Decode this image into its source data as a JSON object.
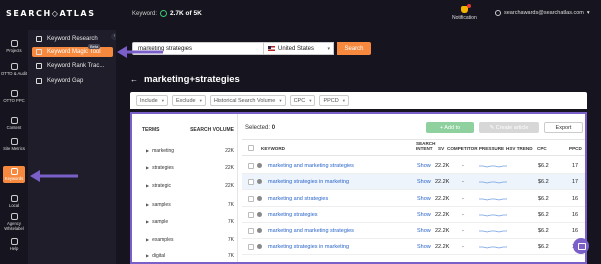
{
  "header": {
    "logo": "SEARCH◇ATLAS",
    "keyword_label": "Keyword:",
    "keyword_quota": "2.7K of 5K",
    "notification_label": "Notification",
    "account_email": "searchawards@searchatlas.com"
  },
  "rail": {
    "items": [
      {
        "label": "Projects",
        "icon": "folder-icon"
      },
      {
        "label": "OTTO & Audit",
        "icon": "otto-icon"
      },
      {
        "label": "OTTO PPC",
        "icon": "ppc-icon"
      },
      {
        "label": "Content",
        "icon": "content-icon"
      },
      {
        "label": "Site Metrics",
        "icon": "metrics-icon"
      },
      {
        "label": "Keywords",
        "icon": "keywords-icon"
      },
      {
        "label": "Local",
        "icon": "local-icon"
      },
      {
        "label": "Agency Whitelabel",
        "icon": "agency-icon"
      },
      {
        "label": "Help",
        "icon": "help-icon"
      }
    ]
  },
  "submenu": {
    "items": [
      {
        "label": "Keyword Research",
        "icon": "search-icon"
      },
      {
        "label": "Keyword Magic Tool",
        "icon": "magic-wand-icon",
        "badge": "Beta"
      },
      {
        "label": "Keyword Rank Trac...",
        "icon": "rank-icon"
      },
      {
        "label": "Keyword Gap",
        "icon": "gap-icon"
      }
    ],
    "beta_badge": "Beta"
  },
  "search": {
    "query": "marketing strategies",
    "country": "United States",
    "button": "Search"
  },
  "page": {
    "title": "marketing+strategies",
    "back_glyph": "←"
  },
  "filters": [
    "Include",
    "Exclude",
    "Historical Search Volume",
    "CPC",
    "PPCD"
  ],
  "groups": {
    "header_terms": "TERMS",
    "header_volume": "SEARCH VOLUME",
    "rows": [
      {
        "term": "marketing",
        "volume": "22K"
      },
      {
        "term": "strategies",
        "volume": "22K"
      },
      {
        "term": "strategic",
        "volume": "22K"
      },
      {
        "term": "samples",
        "volume": "7K"
      },
      {
        "term": "sample",
        "volume": "7K"
      },
      {
        "term": "examples",
        "volume": "7K"
      },
      {
        "term": "digital",
        "volume": "7K"
      }
    ]
  },
  "toolbar": {
    "selected_label": "Selected:",
    "selected_count": "0",
    "add_to": "+ Add to",
    "create_article": "✎ Create article",
    "export": "Export"
  },
  "table": {
    "headers": {
      "keyword": "KEYWORD",
      "intent": "SEARCH INTENT",
      "sv": "SV",
      "competition": "COMPETITOR PRESSURE",
      "trend": "HSV TREND",
      "cpc": "CPC",
      "ppcd": "PPCD"
    },
    "rows": [
      {
        "keyword": "marketing and marketing strategies",
        "intent": "Show",
        "sv": "22.2K",
        "competition": "-",
        "cpc": "$6.2",
        "ppcd": "17"
      },
      {
        "keyword": "marketing strategies in marketing",
        "intent": "Show",
        "sv": "22.2K",
        "competition": "-",
        "cpc": "$6.2",
        "ppcd": "17"
      },
      {
        "keyword": "marketing and strategies",
        "intent": "Show",
        "sv": "22.2K",
        "competition": "-",
        "cpc": "$6.2",
        "ppcd": "16"
      },
      {
        "keyword": "marketing strategies",
        "intent": "Show",
        "sv": "22.2K",
        "competition": "-",
        "cpc": "$6.2",
        "ppcd": "16"
      },
      {
        "keyword": "marketing and marketing strategies",
        "intent": "Show",
        "sv": "22.2K",
        "competition": "-",
        "cpc": "$6.2",
        "ppcd": "16"
      },
      {
        "keyword": "marketing strategies in marketing",
        "intent": "Show",
        "sv": "22.2K",
        "competition": "-",
        "cpc": "$6.2",
        "ppcd": "16"
      }
    ]
  },
  "colors": {
    "accent_orange": "#f7893f",
    "highlight_purple": "#7a5fc8",
    "link_blue": "#2a65c9",
    "dark_bg": "#16151f"
  }
}
